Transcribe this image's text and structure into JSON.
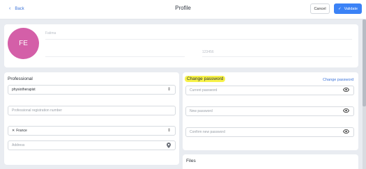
{
  "header": {
    "back_label": "Back",
    "title": "Profile",
    "cancel_label": "Cancel",
    "validate_label": "Validate"
  },
  "profile": {
    "initials": "FE",
    "first_name": "Fatima",
    "phone": "123456"
  },
  "professional": {
    "section_title": "Professional",
    "profession_value": "physiotherapist",
    "registration_placeholder": "Professional registration number",
    "country_value": "France",
    "address_placeholder": "Address"
  },
  "password": {
    "section_title": "Change password",
    "link_label": "Change password",
    "current_placeholder": "Current password",
    "new_placeholder": "New password",
    "confirm_placeholder": "Confirm new password"
  },
  "files": {
    "section_title": "Files"
  },
  "colors": {
    "accent": "#3b82f6",
    "avatar_bg": "#d45fa8",
    "highlight": "#f7f24a"
  }
}
